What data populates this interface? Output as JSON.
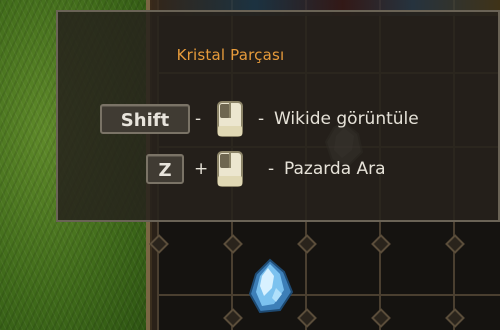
{
  "tooltip": {
    "title": "Kristal Parçası",
    "row1": {
      "key": "Shift",
      "op": "-",
      "dash": "-",
      "action": "Wikide görüntüle"
    },
    "row2": {
      "key": "Z",
      "op": "+",
      "dash": "-",
      "action": "Pazarda Ara"
    }
  },
  "colors": {
    "title": "#e79b3b",
    "text": "#e6e2d8",
    "tooltip_bg": "#26221c",
    "grass": "#4f7a22",
    "grid_line": "#4a3f30"
  },
  "icons": {
    "mouse": "mouse-left-click-icon",
    "item": "crystal-shard-icon"
  }
}
